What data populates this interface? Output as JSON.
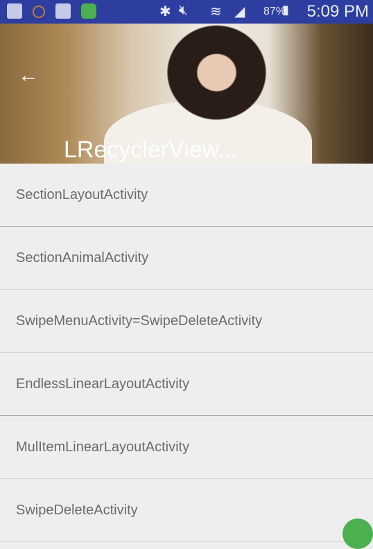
{
  "status_bar": {
    "time": "5:09 PM",
    "battery": "87%",
    "notification_icons": [
      "bird-app-icon",
      "face-icon",
      "bird-app-icon",
      "cloud-app-icon"
    ],
    "system_icons": [
      "bluetooth-icon",
      "mute-icon",
      "wifi-icon",
      "signal-icon",
      "battery-charging-icon"
    ],
    "color": "#2e3ea0"
  },
  "toolbar": {
    "title": "LRecyclerView...",
    "back_icon": "arrow-left-icon"
  },
  "list": {
    "items": [
      {
        "label": "SectionLayoutActivity"
      },
      {
        "label": "SectionAnimalActivity"
      },
      {
        "label": "SwipeMenuActivity=SwipeDeleteActivity"
      },
      {
        "label": "EndlessLinearLayoutActivity"
      },
      {
        "label": "MulItemLinearLayoutActivity"
      },
      {
        "label": "SwipeDeleteActivity"
      }
    ]
  },
  "fab": {
    "color": "#4caf50"
  }
}
